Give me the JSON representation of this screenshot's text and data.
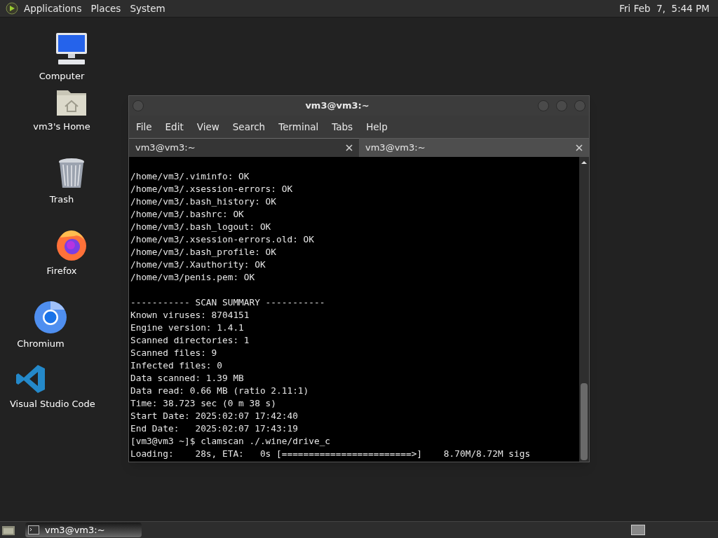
{
  "top_panel": {
    "menus": [
      "Applications",
      "Places",
      "System"
    ],
    "clock": "Fri Feb  7,  5:44 PM"
  },
  "desktop_icons": [
    {
      "kind": "computer",
      "label": "Computer"
    },
    {
      "kind": "home",
      "label": "vm3's Home"
    },
    {
      "kind": "trash",
      "label": "Trash"
    },
    {
      "kind": "firefox",
      "label": "Firefox"
    },
    {
      "kind": "chromium",
      "label": "Chromium"
    },
    {
      "kind": "vscode",
      "label": "Visual Studio Code"
    }
  ],
  "window": {
    "title": "vm3@vm3:~",
    "menu": [
      "File",
      "Edit",
      "View",
      "Search",
      "Terminal",
      "Tabs",
      "Help"
    ],
    "tabs": [
      {
        "label": "vm3@vm3:~",
        "selected": true
      },
      {
        "label": "vm3@vm3:~",
        "selected": false
      }
    ],
    "terminal": {
      "results": [
        "/home/vm3/.viminfo: OK",
        "/home/vm3/.xsession-errors: OK",
        "/home/vm3/.bash_history: OK",
        "/home/vm3/.bashrc: OK",
        "/home/vm3/.bash_logout: OK",
        "/home/vm3/.xsession-errors.old: OK",
        "/home/vm3/.bash_profile: OK",
        "/home/vm3/.Xauthority: OK",
        "/home/vm3/penis.pem: OK"
      ],
      "summary": [
        "----------- SCAN SUMMARY -----------",
        "Known viruses: 8704151",
        "Engine version: 1.4.1",
        "Scanned directories: 1",
        "Scanned files: 9",
        "Infected files: 0",
        "Data scanned: 1.39 MB",
        "Data read: 0.66 MB (ratio 2.11:1)",
        "Time: 38.723 sec (0 m 38 s)",
        "Start Date: 2025:02:07 17:42:40",
        "End Date:   2025:02:07 17:43:19",
        "[vm3@vm3 ~]$ clamscan ./.wine/drive_c",
        "Loading:    28s, ETA:   0s [========================>]    8.70M/8.72M sigs"
      ]
    }
  },
  "taskbar": {
    "tasks": [
      {
        "label": "vm3@vm3:~",
        "selected": true
      }
    ]
  }
}
